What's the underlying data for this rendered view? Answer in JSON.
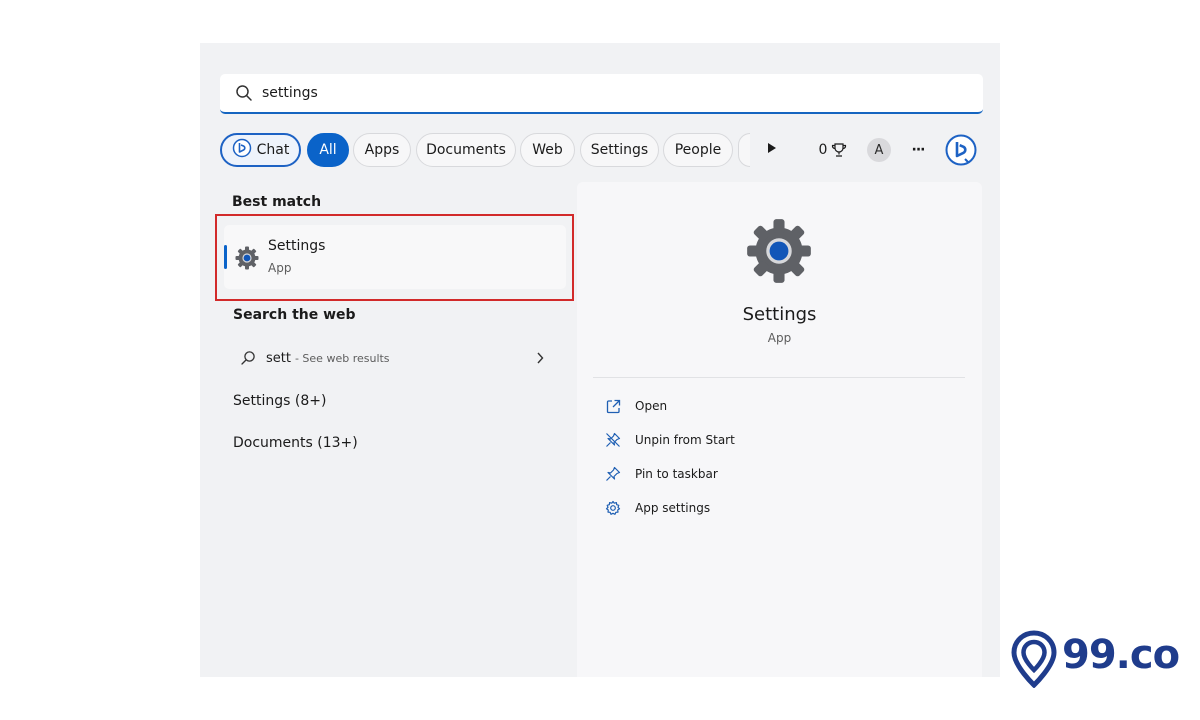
{
  "search": {
    "value": "settings"
  },
  "filters": {
    "chat": "Chat",
    "all": "All",
    "apps": "Apps",
    "documents": "Documents",
    "web": "Web",
    "settings": "Settings",
    "people": "People",
    "points": "0",
    "avatar_initial": "A",
    "more": "···"
  },
  "best_match": {
    "header": "Best match",
    "title": "Settings",
    "subtitle": "App"
  },
  "search_web": {
    "header": "Search the web",
    "query": "sett",
    "hint": "- See web results"
  },
  "groups": [
    "Settings (8+)",
    "Documents (13+)"
  ],
  "preview": {
    "title": "Settings",
    "subtitle": "App",
    "actions": [
      "Open",
      "Unpin from Start",
      "Pin to taskbar",
      "App settings"
    ]
  },
  "watermark": "99.co",
  "colors": {
    "accent": "#0a63c9",
    "highlight": "#d22a2a",
    "brand": "#1f3c8c"
  },
  "icons": {
    "search": "search-icon",
    "chat": "bing-chat-icon",
    "play": "play-icon",
    "trophy": "trophy-icon",
    "more": "more-icon",
    "bing": "bing-icon",
    "app": "settings-gear-icon",
    "web": "search-icon",
    "chevron": "chevron-right-icon",
    "open": "open-external-icon",
    "unpin": "unpin-icon",
    "pin": "pin-icon",
    "app_settings": "gear-icon",
    "logo": "location-pin-icon"
  }
}
